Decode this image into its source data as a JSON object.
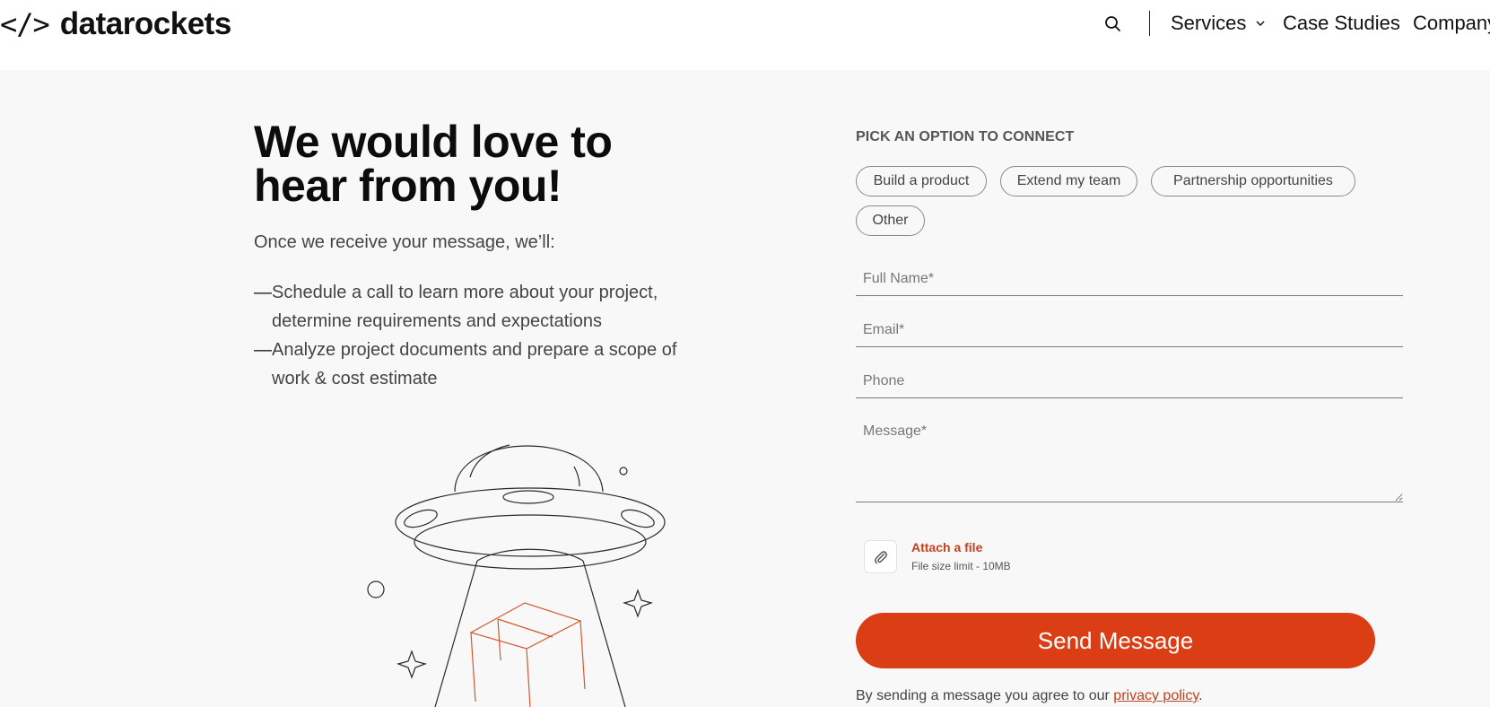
{
  "header": {
    "logo_mark": "</>",
    "logo_text": "datarockets",
    "nav": {
      "services": "Services",
      "case_studies": "Case Studies",
      "company": "Company"
    }
  },
  "hero": {
    "headline_line1": "We would love to",
    "headline_line2": "hear from you!",
    "intro": "Once we receive your message, we’ll:",
    "steps": [
      {
        "dash": "—",
        "text": "Schedule a call to learn more about your project, determine requirements and expectations"
      },
      {
        "dash": "—",
        "text": "Analyze project documents and prepare a scope of work & cost estimate"
      }
    ]
  },
  "form": {
    "pick_label": "PICK AN OPTION TO CONNECT",
    "options": [
      "Build a product",
      "Extend my team",
      "Partnership opportunities",
      "Other"
    ],
    "fields": {
      "full_name": {
        "placeholder": "Full Name*",
        "value": ""
      },
      "email": {
        "placeholder": "Email*",
        "value": ""
      },
      "phone": {
        "placeholder": "Phone",
        "value": ""
      },
      "message": {
        "placeholder": "Message*",
        "value": ""
      }
    },
    "attach_label": "Attach a file",
    "attach_limit": "File size limit - 10MB",
    "send_label": "Send Message",
    "consent_prefix": "By sending a message you agree to our ",
    "consent_link": "privacy policy",
    "consent_suffix": "."
  },
  "colors": {
    "accent": "#db3e14",
    "link": "#c1401d",
    "background": "#f8f8f8",
    "header_bg": "#ffffff"
  },
  "icons": [
    "code-brackets-icon",
    "search-icon",
    "chevron-down-icon",
    "paperclip-icon"
  ]
}
